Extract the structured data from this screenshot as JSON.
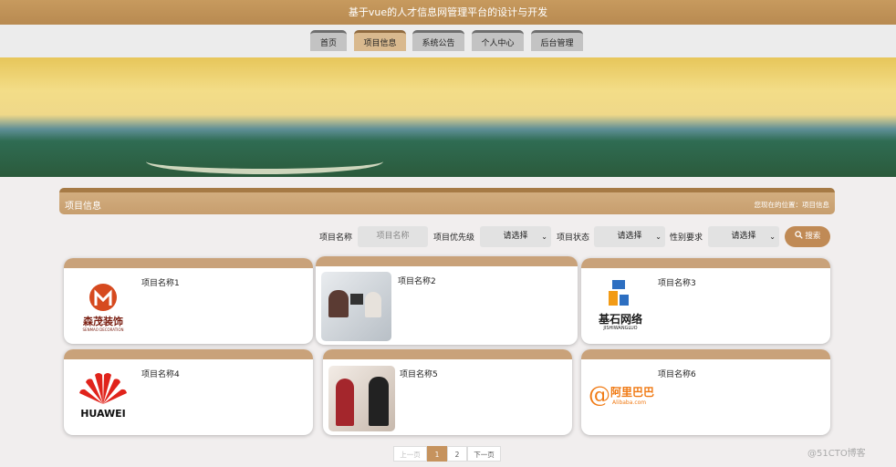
{
  "app": {
    "title": "基于vue的人才信息网管理平台的设计与开发"
  },
  "nav": {
    "items": [
      {
        "label": "首页"
      },
      {
        "label": "项目信息"
      },
      {
        "label": "系统公告"
      },
      {
        "label": "个人中心"
      },
      {
        "label": "后台管理"
      }
    ],
    "active": "项目信息"
  },
  "section": {
    "title": "项目信息",
    "location_label": "您现在的位置：",
    "location_value": "项目信息"
  },
  "search": {
    "name_label": "项目名称",
    "name_placeholder": "项目名称",
    "priority_label": "项目优先级",
    "priority_value": "请选择",
    "status_label": "项目状态",
    "status_value": "请选择",
    "gender_label": "性别要求",
    "gender_value": "请选择",
    "button_label": "搜索"
  },
  "cards": [
    {
      "name": "项目名称1",
      "logo_text": "森茂装饰",
      "logo_sub": "SENMAO DECORATION"
    },
    {
      "name": "项目名称2"
    },
    {
      "name": "项目名称3",
      "logo_text": "基石网络",
      "logo_sub": "JISHIWANGLUO"
    },
    {
      "name": "项目名称4",
      "logo_text": "HUAWEI"
    },
    {
      "name": "项目名称5"
    },
    {
      "name": "项目名称6",
      "logo_text": "阿里巴巴",
      "logo_sub": "Alibaba.com"
    }
  ],
  "pagination": {
    "prev": "上一页",
    "pages": [
      "1",
      "2"
    ],
    "current": "1",
    "next": "下一页"
  },
  "watermark": "@51CTO博客",
  "colors": {
    "accent": "#c6935e",
    "topbar": "#c79a5e",
    "card_header": "#c9a27a"
  }
}
